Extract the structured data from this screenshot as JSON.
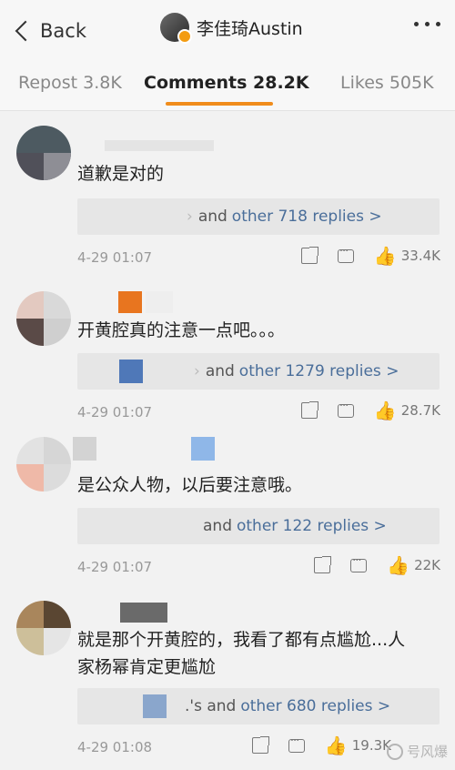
{
  "header": {
    "back_label": "Back",
    "author_name": "李佳琦Austin"
  },
  "tabs": [
    {
      "label": "Repost 3.8K"
    },
    {
      "label": "Comments 28.2K"
    },
    {
      "label": "Likes 505K"
    }
  ],
  "comments": [
    {
      "text_lines": [
        "道歉是对的"
      ],
      "replies_prefix": "and",
      "replies_link": "other 718 replies >",
      "time": "4-29 01:07",
      "likes": "33.4K"
    },
    {
      "text_lines": [
        "开黄腔真的注意一点吧。。。"
      ],
      "replies_prefix": "and",
      "replies_link": "other 1279 replies >",
      "time": "4-29 01:07",
      "likes": "28.7K"
    },
    {
      "text_lines": [
        "是公众人物，以后要注意哦。"
      ],
      "replies_prefix": "and",
      "replies_link": "other 122 replies >",
      "time": "4-29 01:07",
      "likes": "22K"
    },
    {
      "text_lines": [
        "就是那个开黄腔的，我看了都有点尴尬...人",
        "家杨幂肯定更尴尬"
      ],
      "replies_prefix": ".'s and",
      "replies_link": "other 680 replies >",
      "time": "4-29 01:08",
      "likes": "19.3K"
    }
  ],
  "watermark": "号风爆"
}
